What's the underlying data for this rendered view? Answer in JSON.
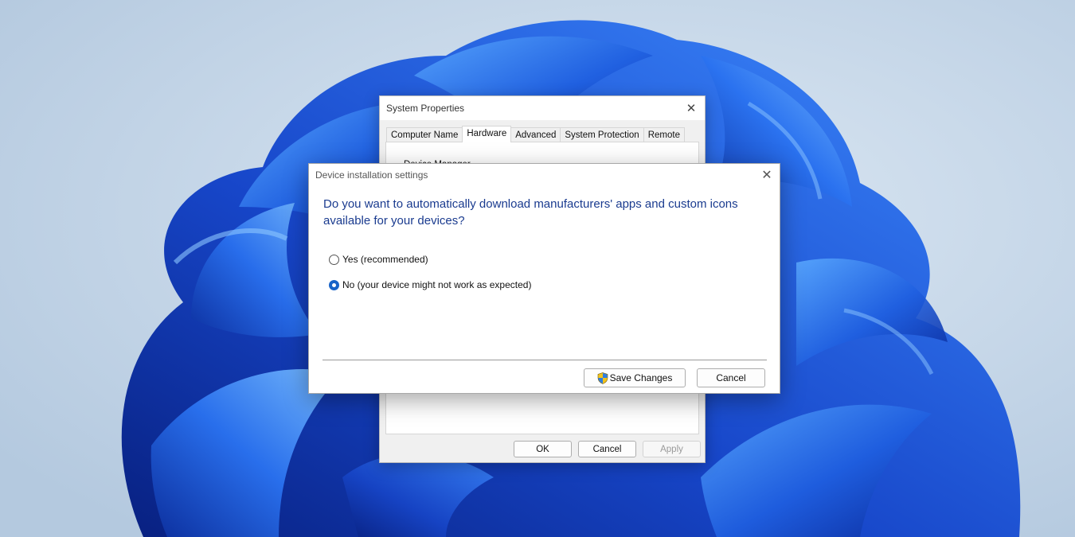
{
  "system_properties": {
    "title": "System Properties",
    "close_glyph": "✕",
    "tabs": [
      {
        "label": "Computer Name",
        "active": false
      },
      {
        "label": "Hardware",
        "active": true
      },
      {
        "label": "Advanced",
        "active": false
      },
      {
        "label": "System Protection",
        "active": false
      },
      {
        "label": "Remote",
        "active": false
      }
    ],
    "panel_heading": "Device Manager",
    "buttons": {
      "ok": "OK",
      "cancel": "Cancel",
      "apply": "Apply"
    }
  },
  "device_installation_dialog": {
    "title": "Device installation settings",
    "close_glyph": "✕",
    "question": "Do you want to automatically download manufacturers' apps and custom icons available for your devices?",
    "options": [
      {
        "label": "Yes (recommended)",
        "selected": false
      },
      {
        "label": "No (your device might not work as expected)",
        "selected": true
      }
    ],
    "buttons": {
      "save": "Save Changes",
      "save_icon": "uac-shield-icon",
      "cancel": "Cancel"
    }
  },
  "colors": {
    "accent": "#1964c8",
    "question_text": "#1a3b8f",
    "wallpaper_bg": "#c5d8ea",
    "wallpaper_bloom": "#1f5fe0"
  }
}
